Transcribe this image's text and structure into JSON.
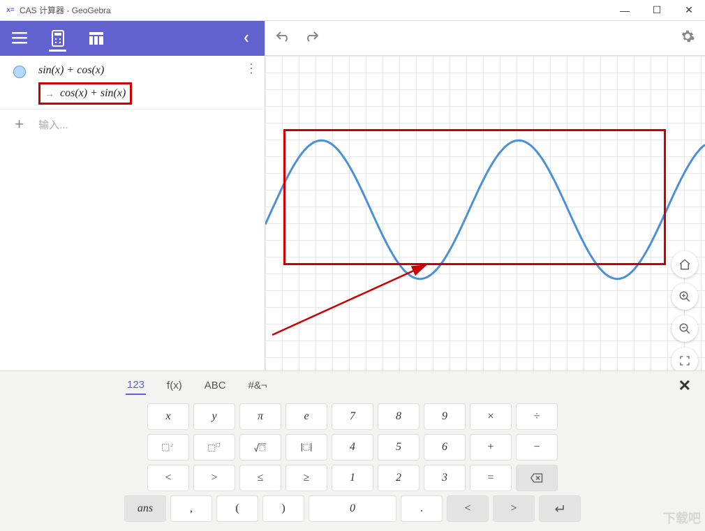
{
  "window": {
    "title": "CAS 计算器 - GeoGebra"
  },
  "cas": {
    "rows": [
      {
        "input": "sin(x) + cos(x)",
        "output": "cos(x) + sin(x)"
      }
    ],
    "input_placeholder": "输入..."
  },
  "keyboard": {
    "tabs": [
      "123",
      "f(x)",
      "ABC",
      "#&¬"
    ],
    "active_tab": 0,
    "rows": [
      [
        "x",
        "y",
        "π",
        "e",
        "7",
        "8",
        "9",
        "×",
        "÷"
      ],
      [
        "▢²",
        "▢▫",
        "√▢",
        "|▢|",
        "4",
        "5",
        "6",
        "+",
        "−"
      ],
      [
        "<",
        ">",
        "≤",
        "≥",
        "1",
        "2",
        "3",
        "=",
        "⌫"
      ],
      [
        "ans",
        ",",
        "(",
        ")",
        "0",
        ".",
        "<",
        ">",
        "↵"
      ]
    ]
  },
  "chart_data": {
    "type": "line",
    "title": "",
    "expression": "sin(x) + cos(x)",
    "series": [
      {
        "name": "sin(x)+cos(x)",
        "x_range": [
          -1,
          13
        ],
        "amplitude": 1.4142,
        "period": 6.2832,
        "phase": 0.7854
      }
    ],
    "xlabel": "",
    "ylabel": "",
    "grid": true
  },
  "watermark": "下载吧"
}
